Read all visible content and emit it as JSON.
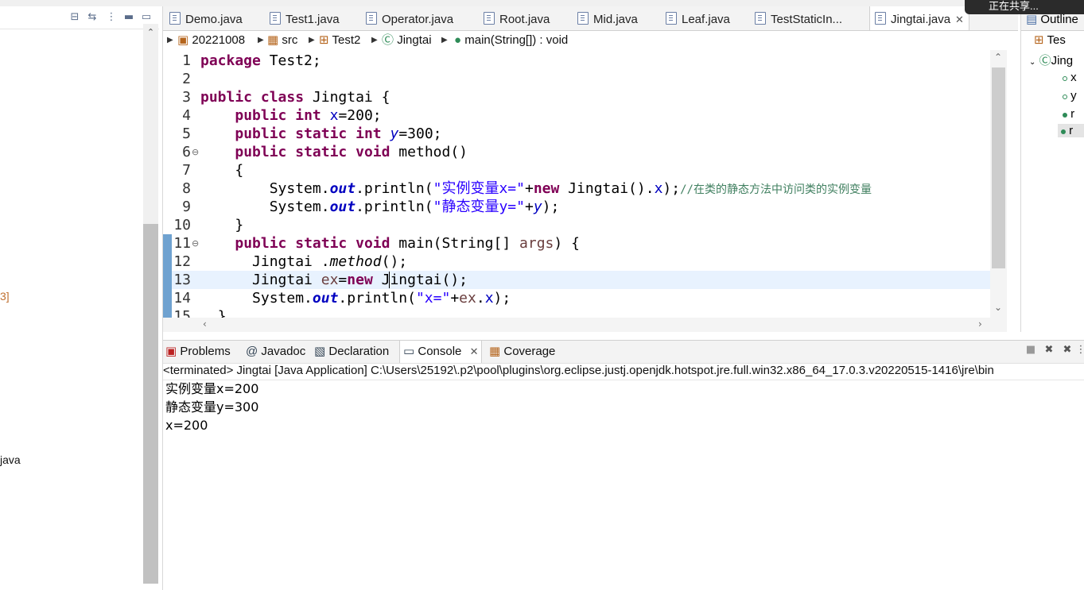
{
  "window": {
    "top_strip_label": ""
  },
  "left_panel": {
    "toolbar_icons": [
      "collapse-all-icon",
      "link-editor-icon",
      "view-menu-icon",
      "minimize-icon",
      "maximize-icon"
    ],
    "fragment_1": "3]",
    "fragment_2": "java"
  },
  "editor": {
    "tabs": [
      {
        "label": "Demo.java"
      },
      {
        "label": "Test1.java"
      },
      {
        "label": "Operator.java"
      },
      {
        "label": "Root.java"
      },
      {
        "label": "Mid.java"
      },
      {
        "label": "Leaf.java"
      },
      {
        "label": "TestStaticIn..."
      },
      {
        "label": "Jingtai.java",
        "active": true
      }
    ],
    "breadcrumb": [
      {
        "label": "20221008"
      },
      {
        "label": "src"
      },
      {
        "label": "Test2"
      },
      {
        "label": "Jingtai"
      },
      {
        "label": "main(String[]) : void"
      }
    ],
    "line_numbers": [
      "1",
      "2",
      "3",
      "4",
      "5",
      "6",
      "7",
      "8",
      "9",
      "10",
      "11",
      "12",
      "13",
      "14",
      "15"
    ],
    "code": {
      "l1_kw": "package",
      "l1_rest": " Test2;",
      "l3_kw1": "public",
      "l3_kw2": "class",
      "l3_rest": " Jingtai {",
      "l4_kw1": "public",
      "l4_kw2": "int",
      "l4_fld": "x",
      "l4_rest": "=200;",
      "l5_kw1": "public",
      "l5_kw2": "static",
      "l5_kw3": "int",
      "l5_fld": "y",
      "l5_rest": "=300;",
      "l6_kw1": "public",
      "l6_kw2": "static",
      "l6_kw3": "void",
      "l6_rest": " method()",
      "l7": "{",
      "l8_a": "System.",
      "l8_out": "out",
      "l8_b": ".println(",
      "l8_str": "\"实例变量x=\"",
      "l8_c": "+",
      "l8_kw": "new",
      "l8_d": " Jingtai().",
      "l8_fld": "x",
      "l8_e": ");",
      "l8_cmt": "//在类的静态方法中访问类的实例变量",
      "l9_a": "System.",
      "l9_out": "out",
      "l9_b": ".println(",
      "l9_str": "\"静态变量y=\"",
      "l9_c": "+",
      "l9_fld": "y",
      "l9_e": ");",
      "l10": "}",
      "l11_kw1": "public",
      "l11_kw2": "static",
      "l11_kw3": "void",
      "l11_a": " main(String[] ",
      "l11_var": "args",
      "l11_b": ") {",
      "l12_a": "Jingtai .",
      "l12_m": "method",
      "l12_b": "();",
      "l13_a": "Jingtai ",
      "l13_var": "ex",
      "l13_b": "=",
      "l13_kw": "new",
      "l13_c": " J",
      "l13_d": "ingtai();",
      "l14_a": "System.",
      "l14_out": "out",
      "l14_b": ".println(",
      "l14_str": "\"x=\"",
      "l14_c": "+",
      "l14_var": "ex",
      "l14_d": ".",
      "l14_fld": "x",
      "l14_e": ");",
      "l15": "}"
    }
  },
  "outline": {
    "tab_label": "Outline",
    "items": [
      "Tes",
      "Jing",
      "x",
      "y",
      "r",
      "r"
    ]
  },
  "toast": {
    "text": "正在共享..."
  },
  "bottom": {
    "tabs": [
      {
        "label": "Problems"
      },
      {
        "label": "Javadoc"
      },
      {
        "label": "Declaration"
      },
      {
        "label": "Console",
        "active": true
      },
      {
        "label": "Coverage"
      }
    ],
    "console_header": "<terminated> Jingtai [Java Application] C:\\Users\\25192\\.p2\\pool\\plugins\\org.eclipse.justj.openjdk.hotspot.jre.full.win32.x86_64_17.0.3.v20220515-1416\\jre\\bin",
    "output": [
      "实例变量x=200",
      "静态变量y=300",
      "x=200"
    ]
  },
  "colors": {
    "keyword": "#7f0055",
    "field": "#0000c0",
    "string": "#2a00ff",
    "comment": "#3f7f5f",
    "local_var": "#6a3e3e",
    "current_line": "#e8f2fe"
  }
}
